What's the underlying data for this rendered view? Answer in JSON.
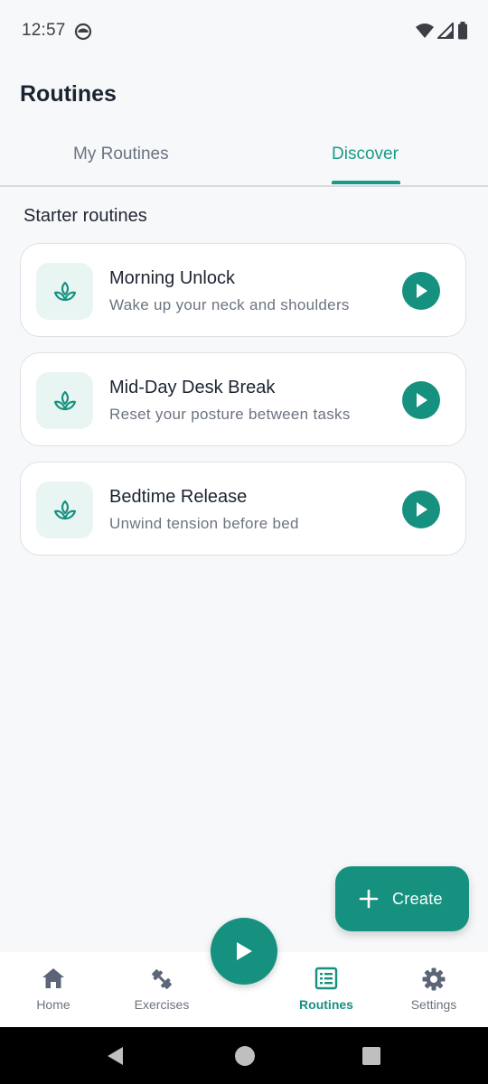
{
  "status_bar": {
    "time": "12:57"
  },
  "page": {
    "title": "Routines"
  },
  "tabs": [
    {
      "label": "My Routines",
      "selected": false
    },
    {
      "label": "Discover",
      "selected": true
    }
  ],
  "section": {
    "title": "Starter routines"
  },
  "routines": [
    {
      "title": "Morning Unlock",
      "subtitle": "Wake up your neck and shoulders",
      "icon": "sprout-icon"
    },
    {
      "title": "Mid-Day Desk Break",
      "subtitle": "Reset your posture between tasks",
      "icon": "sprout-icon"
    },
    {
      "title": "Bedtime Release",
      "subtitle": "Unwind tension before bed",
      "icon": "sprout-icon"
    }
  ],
  "fab": {
    "label": "Create",
    "icon": "plus-icon"
  },
  "bottom_nav": [
    {
      "label": "Home",
      "icon": "home-icon",
      "selected": false
    },
    {
      "label": "Exercises",
      "icon": "dumbbell-icon",
      "selected": false
    },
    {
      "label": "Routines",
      "icon": "list-icon",
      "selected": true
    },
    {
      "label": "Settings",
      "icon": "gear-icon",
      "selected": false
    }
  ],
  "colors": {
    "accent": "#16917f",
    "accent_light": "#e8f5f2",
    "background": "#f7f8fa"
  }
}
